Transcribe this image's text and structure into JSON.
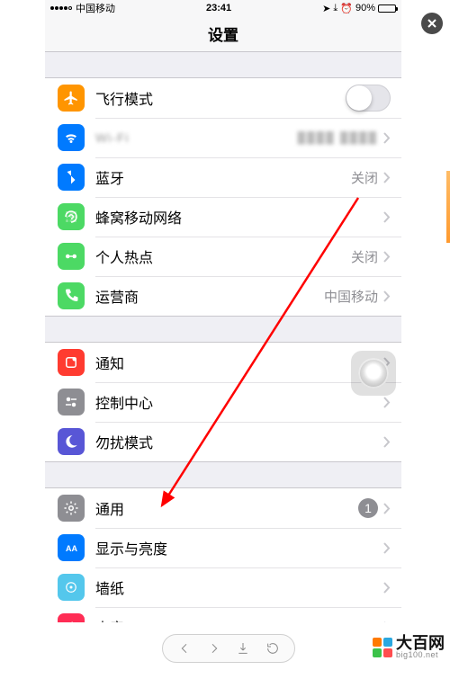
{
  "statusbar": {
    "carrier": "中国移动",
    "time": "23:41",
    "battery_pct": "90%"
  },
  "navbar": {
    "title": "设置"
  },
  "groups": [
    {
      "cells": [
        {
          "icon": "airplane",
          "color": "#ff9500",
          "label": "飞行模式",
          "accessory": "switch"
        },
        {
          "icon": "wifi",
          "color": "#007aff",
          "label": "Wi-Fi",
          "value": "",
          "accessory": "chevron",
          "pixelated": true
        },
        {
          "icon": "bluetooth",
          "color": "#007aff",
          "label": "蓝牙",
          "value": "关闭",
          "accessory": "chevron"
        },
        {
          "icon": "cellular",
          "color": "#4cd964",
          "label": "蜂窝移动网络",
          "accessory": "chevron"
        },
        {
          "icon": "hotspot",
          "color": "#4cd964",
          "label": "个人热点",
          "value": "关闭",
          "accessory": "chevron"
        },
        {
          "icon": "carrier",
          "color": "#4cd964",
          "label": "运营商",
          "value": "中国移动",
          "accessory": "chevron"
        }
      ]
    },
    {
      "cells": [
        {
          "icon": "notification",
          "color": "#ff3b30",
          "label": "通知",
          "accessory": "chevron"
        },
        {
          "icon": "control",
          "color": "#8e8e93",
          "label": "控制中心",
          "accessory": "chevron"
        },
        {
          "icon": "dnd",
          "color": "#5856d6",
          "label": "勿扰模式",
          "accessory": "chevron"
        }
      ]
    },
    {
      "cells": [
        {
          "icon": "general",
          "color": "#8e8e93",
          "label": "通用",
          "badge": "1",
          "accessory": "chevron"
        },
        {
          "icon": "display",
          "color": "#007aff",
          "label": "显示与亮度",
          "accessory": "chevron"
        },
        {
          "icon": "wallpaper",
          "color": "#54c7ec",
          "label": "墙纸",
          "accessory": "chevron"
        },
        {
          "icon": "sound",
          "color": "#ff2d55",
          "label": "声音",
          "accessory": "chevron"
        }
      ]
    }
  ],
  "watermark": {
    "main": "大百网",
    "sub": "big100.net"
  }
}
